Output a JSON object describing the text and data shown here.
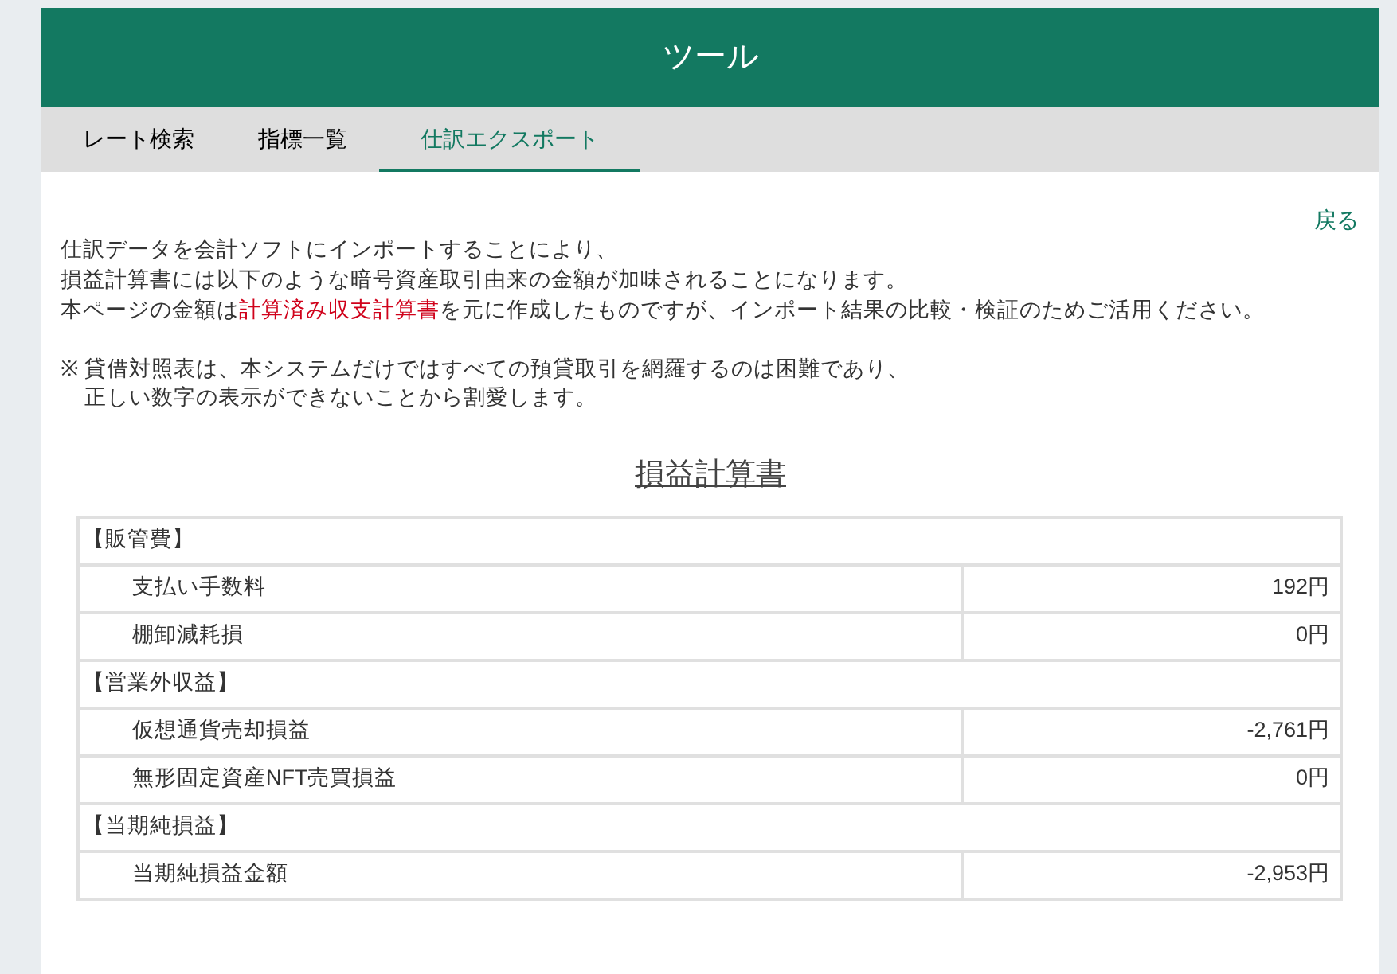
{
  "header": {
    "title": "ツール"
  },
  "tabs": [
    {
      "label": "レート検索",
      "selected": false
    },
    {
      "label": "指標一覧",
      "selected": false
    },
    {
      "label": "仕訳エクスポート",
      "selected": true
    }
  ],
  "back_link": "戻る",
  "intro": [
    [
      {
        "kind": "text",
        "text": "仕訳データを会計ソフトにインポートすることにより、"
      }
    ],
    [
      {
        "kind": "text",
        "text": "損益計算書には以下のような暗号資産取引由来の金額が加味されることになります。"
      }
    ],
    [
      {
        "kind": "text",
        "text": "本ページの金額は"
      },
      {
        "kind": "link",
        "text": "計算済み収支計算書"
      },
      {
        "kind": "text",
        "text": "を元に作成したものですが、インポート結果の比較・検証のためご活用ください。"
      }
    ]
  ],
  "note": {
    "mark": "※",
    "lines": [
      "貸借対照表は、本システムだけではすべての預貸取引を網羅するのは困難であり、",
      "正しい数字の表示ができないことから割愛します。"
    ]
  },
  "statement": {
    "title": "損益計算書",
    "rows": [
      {
        "kind": "section",
        "label": "【販管費】"
      },
      {
        "kind": "item",
        "label": "支払い手数料",
        "amount": "192円"
      },
      {
        "kind": "item",
        "label": "棚卸減耗損",
        "amount": "0円"
      },
      {
        "kind": "section",
        "label": "【営業外収益】"
      },
      {
        "kind": "item",
        "label": "仮想通貨売却損益",
        "amount": "-2,761円"
      },
      {
        "kind": "item",
        "label": "無形固定資産NFT売買損益",
        "amount": "0円"
      },
      {
        "kind": "section",
        "label": "【当期純損益】"
      },
      {
        "kind": "item",
        "label": "当期純損益金額",
        "amount": "-2,953円"
      }
    ]
  }
}
